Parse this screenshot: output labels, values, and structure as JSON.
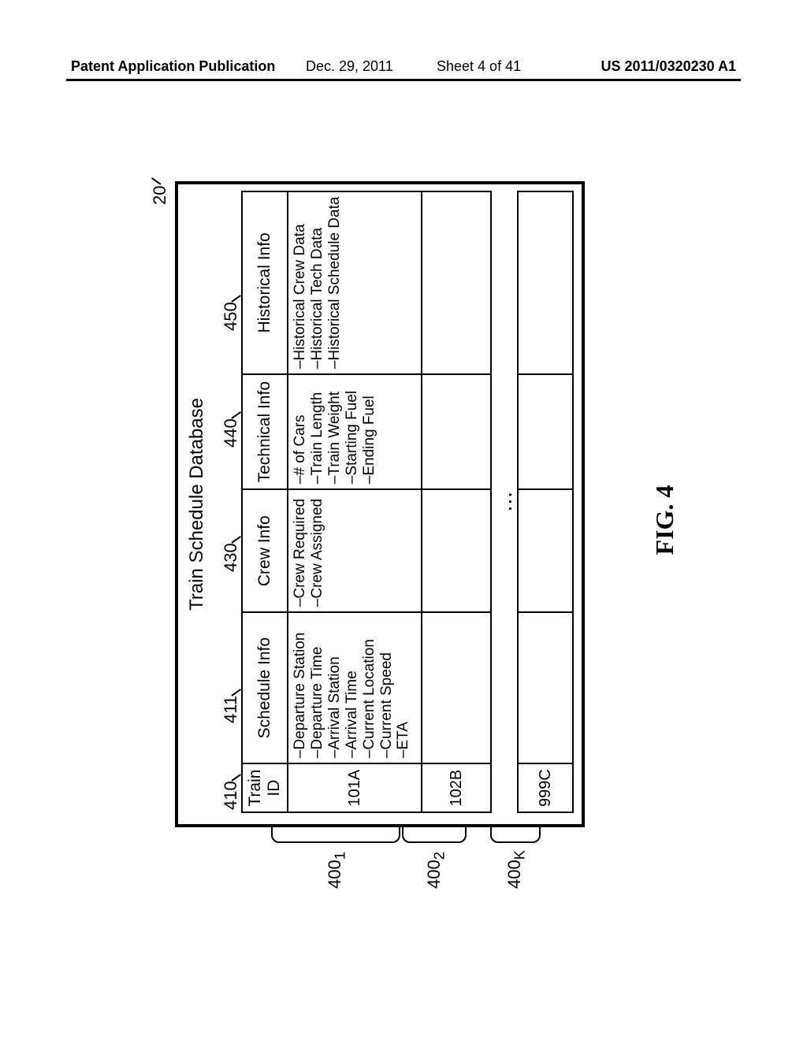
{
  "header": {
    "left": "Patent Application Publication",
    "date": "Dec. 29, 2011",
    "sheet": "Sheet 4 of 41",
    "right": "US 2011/0320230 A1"
  },
  "figure": {
    "caption": "FIG. 4",
    "title": "Train Schedule Database",
    "db_ref": "20",
    "cols": {
      "train_id": {
        "ref": "410",
        "label": "Train ID"
      },
      "schedule": {
        "ref": "411",
        "label": "Schedule Info"
      },
      "crew": {
        "ref": "430",
        "label": "Crew Info"
      },
      "tech": {
        "ref": "440",
        "label": "Technical Info"
      },
      "hist": {
        "ref": "450",
        "label": "Historical Info"
      }
    },
    "rows": [
      {
        "ref": "400",
        "ref_sub": "1",
        "id": "101A",
        "schedule": "–Departure Station\n–Departure Time\n–Arrival Station\n–Arrival Time\n–Current Location\n–Current Speed\n–ETA",
        "crew": "–Crew Required\n–Crew Assigned",
        "tech": "–# of Cars\n–Train Length\n–Train Weight\n–Starting Fuel\n–Ending Fuel",
        "hist": "–Historical Crew Data\n–Historical Tech Data\n–Historical Schedule Data"
      },
      {
        "ref": "400",
        "ref_sub": "2",
        "id": "102B",
        "schedule": "",
        "crew": "",
        "tech": "",
        "hist": ""
      },
      {
        "ellipsis": true
      },
      {
        "ref": "400",
        "ref_sub": "K",
        "id": "999C",
        "schedule": "",
        "crew": "",
        "tech": "",
        "hist": ""
      }
    ]
  }
}
